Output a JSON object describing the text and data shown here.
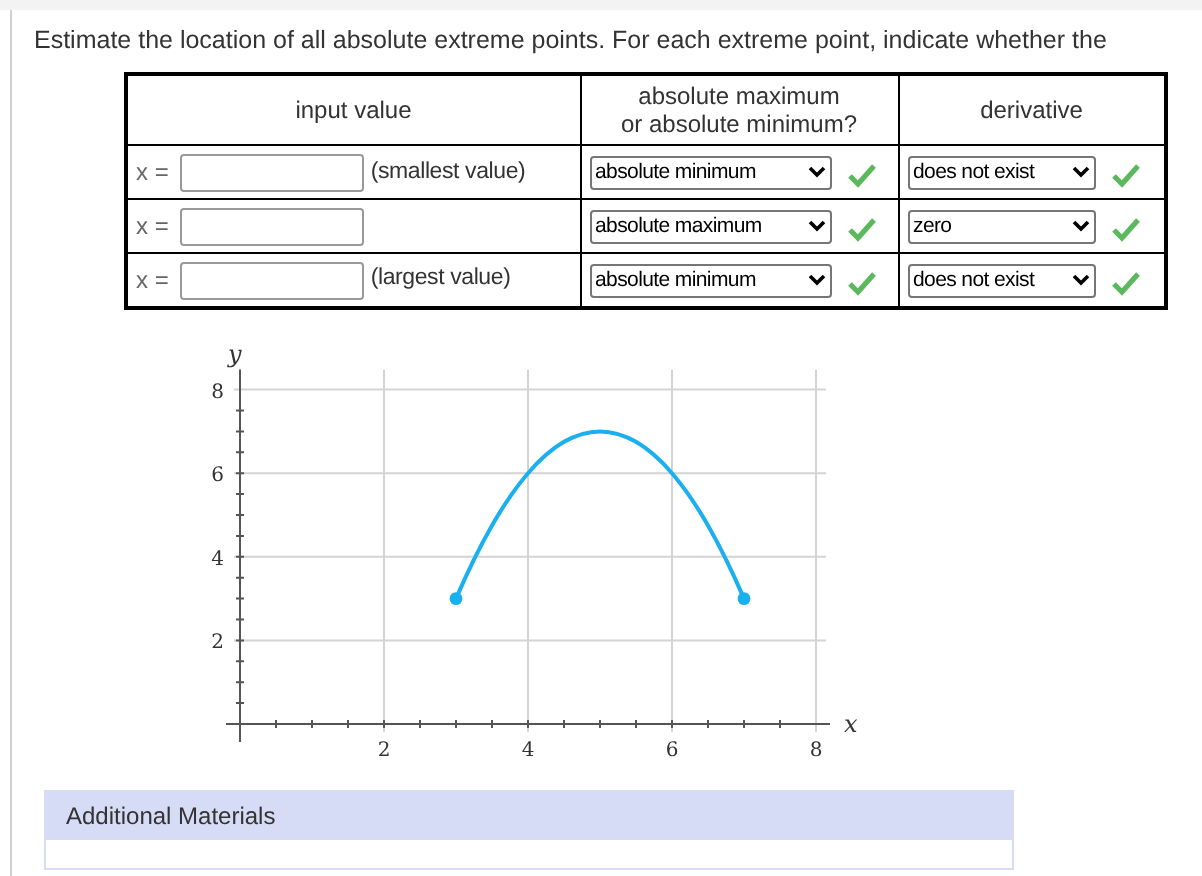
{
  "instruction": "Estimate the location of all absolute extreme points. For each extreme point, indicate whether the",
  "table": {
    "columns": [
      "input value",
      "absolute maximum\nor absolute minimum?",
      "derivative"
    ],
    "rows": [
      {
        "prefix": "x =",
        "note": "(smallest value)",
        "extreme": {
          "value": "absolute minimum",
          "correct": true
        },
        "derivative": {
          "value": "does not exist",
          "correct": true
        }
      },
      {
        "prefix": "x =",
        "extreme": {
          "value": "absolute maximum",
          "correct": true
        },
        "derivative": {
          "value": "zero",
          "correct": true
        }
      },
      {
        "prefix": "x =",
        "note": "(largest value)",
        "extreme": {
          "value": "absolute minimum",
          "correct": true
        },
        "derivative": {
          "value": "does not exist",
          "correct": true
        }
      }
    ]
  },
  "graph": {
    "chart_data": {
      "type": "line",
      "xlabel": "x",
      "ylabel": "y",
      "x": [
        3,
        3.5,
        4,
        4.5,
        5,
        5.5,
        6,
        6.5,
        7
      ],
      "grid": true,
      "series": [
        {
          "color": "#1ab0f0",
          "values": [
            3,
            4.75,
            6,
            6.75,
            7,
            6.75,
            6,
            4.75,
            3
          ]
        }
      ],
      "xlim": [
        0,
        8
      ],
      "ylim": [
        0,
        8
      ],
      "xticks": [
        2,
        4,
        6,
        8
      ],
      "yticks": [
        2,
        4,
        6,
        8
      ]
    }
  },
  "additional_materials": {
    "title": "Additional Materials"
  }
}
